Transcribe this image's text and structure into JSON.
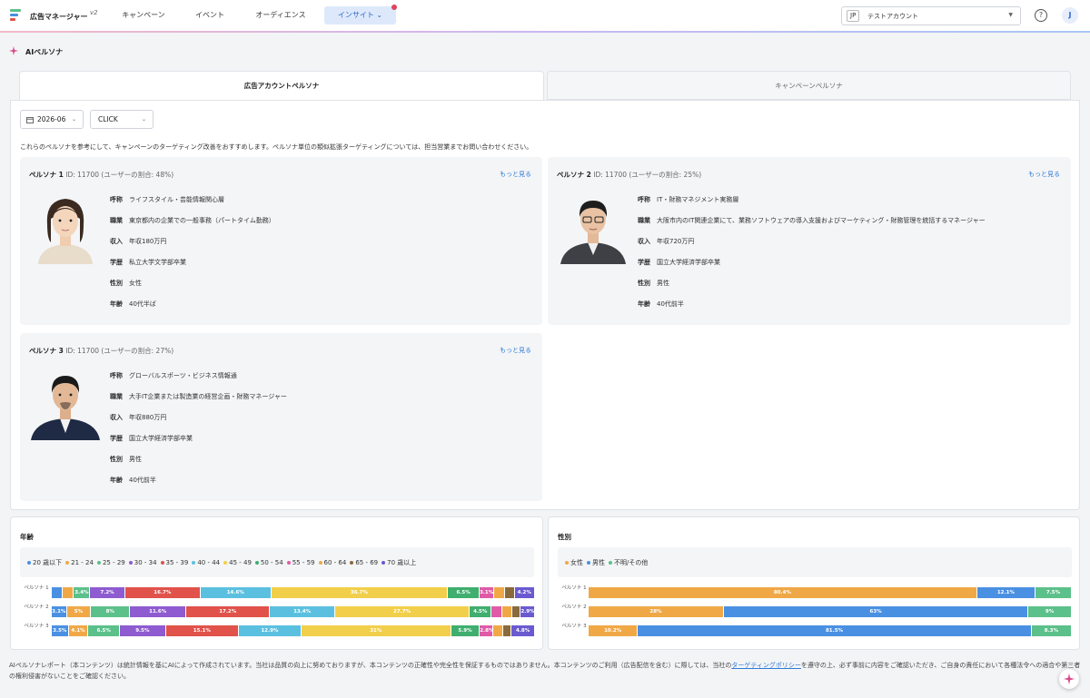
{
  "header": {
    "app_title": "広告マネージャー",
    "version": "v2",
    "nav": [
      {
        "label": "キャンペーン"
      },
      {
        "label": "イベント"
      },
      {
        "label": "オーディエンス"
      },
      {
        "label": "インサイト ⌄",
        "active": true
      }
    ],
    "account": {
      "code": "JP",
      "name": "テストアカウント"
    },
    "help_symbol": "?",
    "avatar_initial": "J"
  },
  "page": {
    "title": "AIペルソナ"
  },
  "tabs": [
    {
      "label": "広告アカウントペルソナ",
      "active": true
    },
    {
      "label": "キャンペーンペルソナ",
      "active": false
    }
  ],
  "filters": {
    "date": "2026-06",
    "metric": "CLICK"
  },
  "intro": "これらのペルソナを参考にして、キャンペーンのターゲティング改善をおすすめします。ペルソナ単位の類似拡張ターゲティングについては、担当営業までお問い合わせください。",
  "more_label": "もっと見る",
  "personas": [
    {
      "name": "ペルソナ 1",
      "meta": "ID: 11700 (ユーザーの割合: 48%)",
      "fields": [
        {
          "k": "呼称",
          "v": "ライフスタイル・芸能情報関心層"
        },
        {
          "k": "職業",
          "v": "東京都内の企業での一般事務（パートタイム勤務）"
        },
        {
          "k": "収入",
          "v": "年収180万円"
        },
        {
          "k": "学歴",
          "v": "私立大学文学部卒業"
        },
        {
          "k": "性別",
          "v": "女性"
        },
        {
          "k": "年齢",
          "v": "40代半ば"
        }
      ]
    },
    {
      "name": "ペルソナ 2",
      "meta": "ID: 11700 (ユーザーの割合: 25%)",
      "fields": [
        {
          "k": "呼称",
          "v": "IT・財務マネジメント実務層"
        },
        {
          "k": "職業",
          "v": "大阪市内のIT関連企業にて、業務ソフトウェアの導入支援およびマーケティング・財務管理を統括するマネージャー"
        },
        {
          "k": "収入",
          "v": "年収720万円"
        },
        {
          "k": "学歴",
          "v": "国立大学経済学部卒業"
        },
        {
          "k": "性別",
          "v": "男性"
        },
        {
          "k": "年齢",
          "v": "40代前半"
        }
      ]
    },
    {
      "name": "ペルソナ 3",
      "meta": "ID: 11700 (ユーザーの割合: 27%)",
      "fields": [
        {
          "k": "呼称",
          "v": "グローバルスポーツ・ビジネス情報通"
        },
        {
          "k": "職業",
          "v": "大手IT企業または製造業の経営企画・財務マネージャー"
        },
        {
          "k": "収入",
          "v": "年収880万円"
        },
        {
          "k": "学歴",
          "v": "国立大学経済学部卒業"
        },
        {
          "k": "性別",
          "v": "男性"
        },
        {
          "k": "年齢",
          "v": "40代前半"
        }
      ]
    }
  ],
  "age_chart": {
    "title": "年齢",
    "legend": [
      {
        "label": "20 歳以下",
        "color": "#4a90e2"
      },
      {
        "label": "21 - 24",
        "color": "#f0a847"
      },
      {
        "label": "25 - 29",
        "color": "#5bc08a"
      },
      {
        "label": "30 - 34",
        "color": "#8e5bd0"
      },
      {
        "label": "35 - 39",
        "color": "#e0524a"
      },
      {
        "label": "40 - 44",
        "color": "#5bc0e0"
      },
      {
        "label": "45 - 49",
        "color": "#f2cf4a"
      },
      {
        "label": "50 - 54",
        "color": "#3fae6e"
      },
      {
        "label": "55 - 59",
        "color": "#e05aa8"
      },
      {
        "label": "60 - 64",
        "color": "#f0a847"
      },
      {
        "label": "65 - 69",
        "color": "#8a6a3c"
      },
      {
        "label": "70 歳以上",
        "color": "#6a5ad0"
      }
    ],
    "rows": [
      {
        "label": "ペルソナ 1",
        "segments": [
          {
            "v": 2.2,
            "label": "",
            "color": "#4a90e2"
          },
          {
            "v": 2.4,
            "label": "",
            "color": "#f0a847"
          },
          {
            "v": 3.4,
            "label": "3.4%",
            "color": "#5bc08a"
          },
          {
            "v": 7.2,
            "label": "7.2%",
            "color": "#8e5bd0"
          },
          {
            "v": 15.7,
            "label": "16.7%",
            "color": "#e0524a"
          },
          {
            "v": 14.6,
            "label": "14.6%",
            "color": "#5bc0e0"
          },
          {
            "v": 36.7,
            "label": "36.7%",
            "color": "#f2cf4a"
          },
          {
            "v": 6.5,
            "label": "6.5%",
            "color": "#3fae6e"
          },
          {
            "v": 3.1,
            "label": "3.1%",
            "color": "#e05aa8"
          },
          {
            "v": 2.2,
            "label": "",
            "color": "#f0a847"
          },
          {
            "v": 2.0,
            "label": "",
            "color": "#8a6a3c"
          },
          {
            "v": 4.2,
            "label": "4.2%",
            "color": "#6a5ad0"
          }
        ]
      },
      {
        "label": "ペルソナ 2",
        "segments": [
          {
            "v": 3.1,
            "label": "3.1%",
            "color": "#4a90e2"
          },
          {
            "v": 5,
            "label": "5%",
            "color": "#f0a847"
          },
          {
            "v": 8,
            "label": "8%",
            "color": "#5bc08a"
          },
          {
            "v": 11.6,
            "label": "11.6%",
            "color": "#8e5bd0"
          },
          {
            "v": 17.2,
            "label": "17.2%",
            "color": "#e0524a"
          },
          {
            "v": 13.4,
            "label": "13.4%",
            "color": "#5bc0e0"
          },
          {
            "v": 27.7,
            "label": "27.7%",
            "color": "#f2cf4a"
          },
          {
            "v": 4.5,
            "label": "4.5%",
            "color": "#3fae6e"
          },
          {
            "v": 2.2,
            "label": "",
            "color": "#e05aa8"
          },
          {
            "v": 2.0,
            "label": "",
            "color": "#f0a847"
          },
          {
            "v": 1.8,
            "label": "",
            "color": "#8a6a3c"
          },
          {
            "v": 2.9,
            "label": "2.9%",
            "color": "#6a5ad0"
          }
        ]
      },
      {
        "label": "ペルソナ 3",
        "segments": [
          {
            "v": 3.5,
            "label": "3.5%",
            "color": "#4a90e2"
          },
          {
            "v": 4.1,
            "label": "4.1%",
            "color": "#f0a847"
          },
          {
            "v": 6.5,
            "label": "6.5%",
            "color": "#5bc08a"
          },
          {
            "v": 9.5,
            "label": "9.5%",
            "color": "#8e5bd0"
          },
          {
            "v": 15.1,
            "label": "15.1%",
            "color": "#e0524a"
          },
          {
            "v": 12.9,
            "label": "12.9%",
            "color": "#5bc0e0"
          },
          {
            "v": 31,
            "label": "31%",
            "color": "#f2cf4a"
          },
          {
            "v": 5.9,
            "label": "5.9%",
            "color": "#3fae6e"
          },
          {
            "v": 2.8,
            "label": "2.8%",
            "color": "#e05aa8"
          },
          {
            "v": 2.0,
            "label": "",
            "color": "#f0a847"
          },
          {
            "v": 1.8,
            "label": "",
            "color": "#8a6a3c"
          },
          {
            "v": 4.8,
            "label": "4.8%",
            "color": "#6a5ad0"
          }
        ]
      }
    ]
  },
  "gender_chart": {
    "title": "性別",
    "legend": [
      {
        "label": "女性",
        "color": "#f0a847"
      },
      {
        "label": "男性",
        "color": "#4a90e2"
      },
      {
        "label": "不明/その他",
        "color": "#5bc08a"
      }
    ],
    "rows": [
      {
        "label": "ペルソナ 1",
        "segments": [
          {
            "v": 80.4,
            "label": "80.4%",
            "color": "#f0a847"
          },
          {
            "v": 12.1,
            "label": "12.1%",
            "color": "#4a90e2"
          },
          {
            "v": 7.5,
            "label": "7.5%",
            "color": "#5bc08a"
          }
        ]
      },
      {
        "label": "ペルソナ 2",
        "segments": [
          {
            "v": 28,
            "label": "28%",
            "color": "#f0a847"
          },
          {
            "v": 63,
            "label": "63%",
            "color": "#4a90e2"
          },
          {
            "v": 9,
            "label": "9%",
            "color": "#5bc08a"
          }
        ]
      },
      {
        "label": "ペルソナ 3",
        "segments": [
          {
            "v": 10.2,
            "label": "10.2%",
            "color": "#f0a847"
          },
          {
            "v": 81.5,
            "label": "81.5%",
            "color": "#4a90e2"
          },
          {
            "v": 8.3,
            "label": "8.3%",
            "color": "#5bc08a"
          }
        ]
      }
    ]
  },
  "footer": {
    "before": "AIペルソナレポート（本コンテンツ）は統計情報を基にAIによって作成されています。当社は品質の向上に努めておりますが、本コンテンツの正確性や完全性を保証するものではありません。本コンテンツのご利用（広告配信を含む）に際しては、当社の",
    "link": "ターゲティングポリシー",
    "after": "を遵守の上、必ず事前に内容をご確認いただき、ご自身の責任において各種法令への適合や第三者の権利侵害がないことをご確認ください。"
  }
}
